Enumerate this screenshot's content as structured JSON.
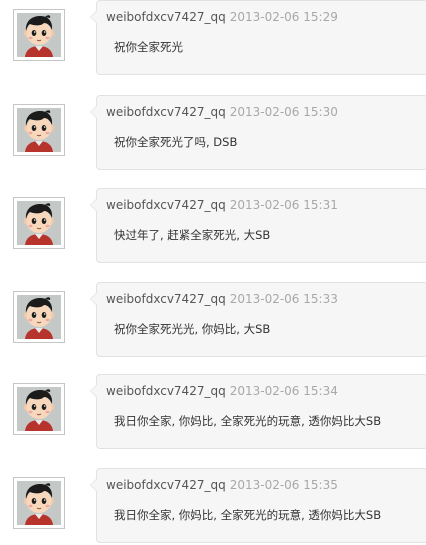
{
  "comments": [
    {
      "username": "weibofdxcv7427_qq",
      "timestamp": "2013-02-06 15:29",
      "text": "祝你全家死光",
      "avatar": "cartoon-boy-avatar"
    },
    {
      "username": "weibofdxcv7427_qq",
      "timestamp": "2013-02-06 15:30",
      "text": "祝你全家死光了吗, DSB",
      "avatar": "cartoon-boy-avatar"
    },
    {
      "username": "weibofdxcv7427_qq",
      "timestamp": "2013-02-06 15:31",
      "text": "快过年了, 赶紧全家死光, 大SB",
      "avatar": "cartoon-boy-avatar"
    },
    {
      "username": "weibofdxcv7427_qq",
      "timestamp": "2013-02-06 15:33",
      "text": "祝你全家死光光, 你妈比, 大SB",
      "avatar": "cartoon-boy-avatar"
    },
    {
      "username": "weibofdxcv7427_qq",
      "timestamp": "2013-02-06 15:34",
      "text": "我日你全家, 你妈比, 全家死光的玩意, 透你妈比大SB",
      "avatar": "cartoon-boy-avatar"
    },
    {
      "username": "weibofdxcv7427_qq",
      "timestamp": "2013-02-06 15:35",
      "text": "我日你全家, 你妈比, 全家死光的玩意, 透你妈比大SB",
      "avatar": "cartoon-boy-avatar"
    }
  ],
  "colors": {
    "bubble_background": "#f6f6f6",
    "bubble_border": "#e2e2e2",
    "username": "#555555",
    "timestamp": "#a8a8a8",
    "text": "#333333"
  }
}
